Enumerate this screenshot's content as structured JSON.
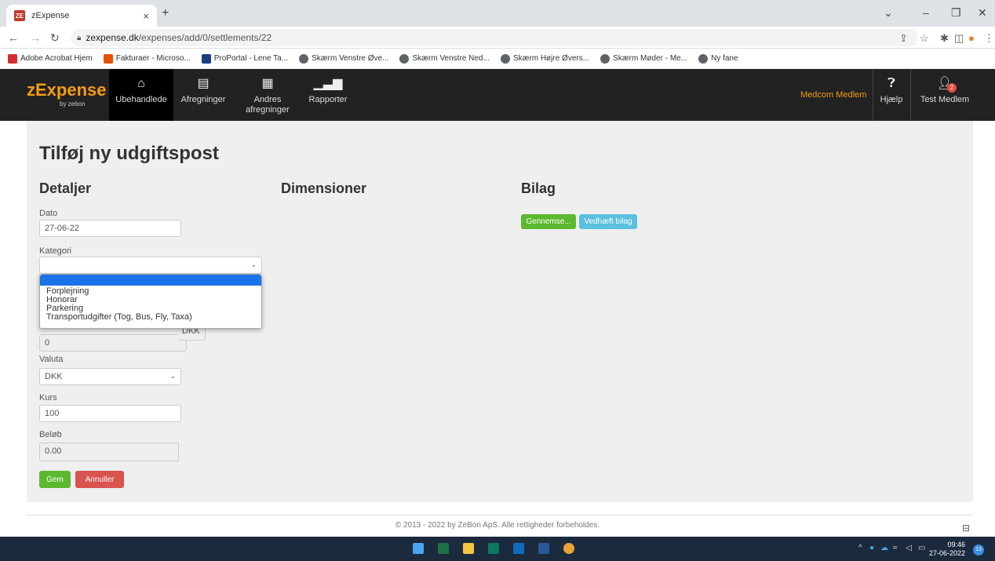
{
  "browser": {
    "tab_title": "zExpense",
    "tab_close": "×",
    "new_tab": "+",
    "url_host": "zexpense.dk",
    "url_path": "/expenses/add/0/settlements/22",
    "bookmarks": [
      "Adobe Acrobat Hjem",
      "Fakturaer - Microso...",
      "ProPortal - Lene Ta...",
      "Skærm Venstre Øve...",
      "Skærm Venstre Ned...",
      "Skærm Højre Øvers...",
      "Skærm Møder - Me...",
      "Ny fane"
    ]
  },
  "app": {
    "logo": "zExpense",
    "logo_sub": "by zebon",
    "nav": [
      {
        "label": "Ubehandlede",
        "icon": "inbox-icon"
      },
      {
        "label": "Afregninger",
        "icon": "document-icon"
      },
      {
        "label": "Andres afregninger",
        "icon": "documents-icon"
      },
      {
        "label": "Rapporter",
        "icon": "bar-chart-icon"
      }
    ],
    "org": "Medcom Medlem",
    "help": "Hjælp",
    "user": "Test Medlem",
    "user_badge": "2"
  },
  "form": {
    "title": "Tilføj ny udgiftspost",
    "sections": {
      "details": "Detaljer",
      "dimensions": "Dimensioner",
      "attachments": "Bilag"
    },
    "dato_label": "Dato",
    "dato_value": "27-06-22",
    "kategori_label": "Kategori",
    "kategori_options": [
      "Forplejning",
      "Honorar",
      "Parkering",
      "Transportudgifter (Tog, Bus, Fly, Taxa)"
    ],
    "hidden_value": "0",
    "valuta_label": "Valuta",
    "valuta_value": "DKK",
    "kurs_label": "Kurs",
    "kurs_value": "100",
    "belob_label": "Beløb",
    "belob_value": "0.00",
    "belob_currency": "DKK",
    "save": "Gem",
    "cancel": "Annuller",
    "browse": "Gennemse...",
    "attach": "Vedhæft bilag"
  },
  "footer": "© 2013 - 2022 by ZeBon ApS. Alle rettigheder forbeholdes.",
  "taskbar": {
    "time": "09:46",
    "date": "27-06-2022",
    "notifications": "13"
  }
}
